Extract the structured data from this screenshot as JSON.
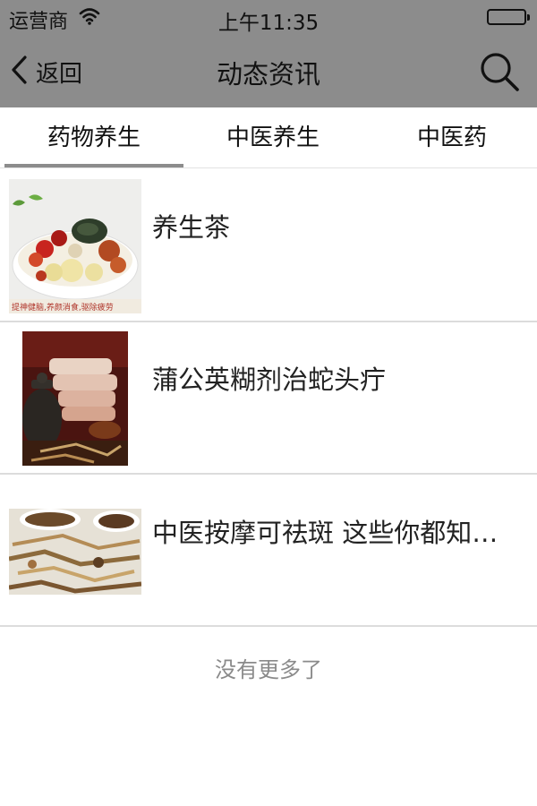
{
  "status_bar": {
    "carrier": "运营商",
    "time": "上午11:35"
  },
  "nav": {
    "back_label": "返回",
    "title": "动态资讯"
  },
  "tabs": [
    {
      "label": "药物养生",
      "active": true
    },
    {
      "label": "中医养生",
      "active": false
    },
    {
      "label": "中医药",
      "active": false
    }
  ],
  "articles": [
    {
      "title": "养生茶",
      "image_caption": "提神健脑,养颜消食,驱除疲劳"
    },
    {
      "title": "蒲公英糊剂治蛇头疔"
    },
    {
      "title": "中医按摩可祛斑 这些你都知道吗"
    }
  ],
  "footer": {
    "no_more": "没有更多了"
  },
  "colors": {
    "bar_gray": "#8c8c8c",
    "divider": "#dcdcdc",
    "footer_text": "#8a8a8a"
  }
}
